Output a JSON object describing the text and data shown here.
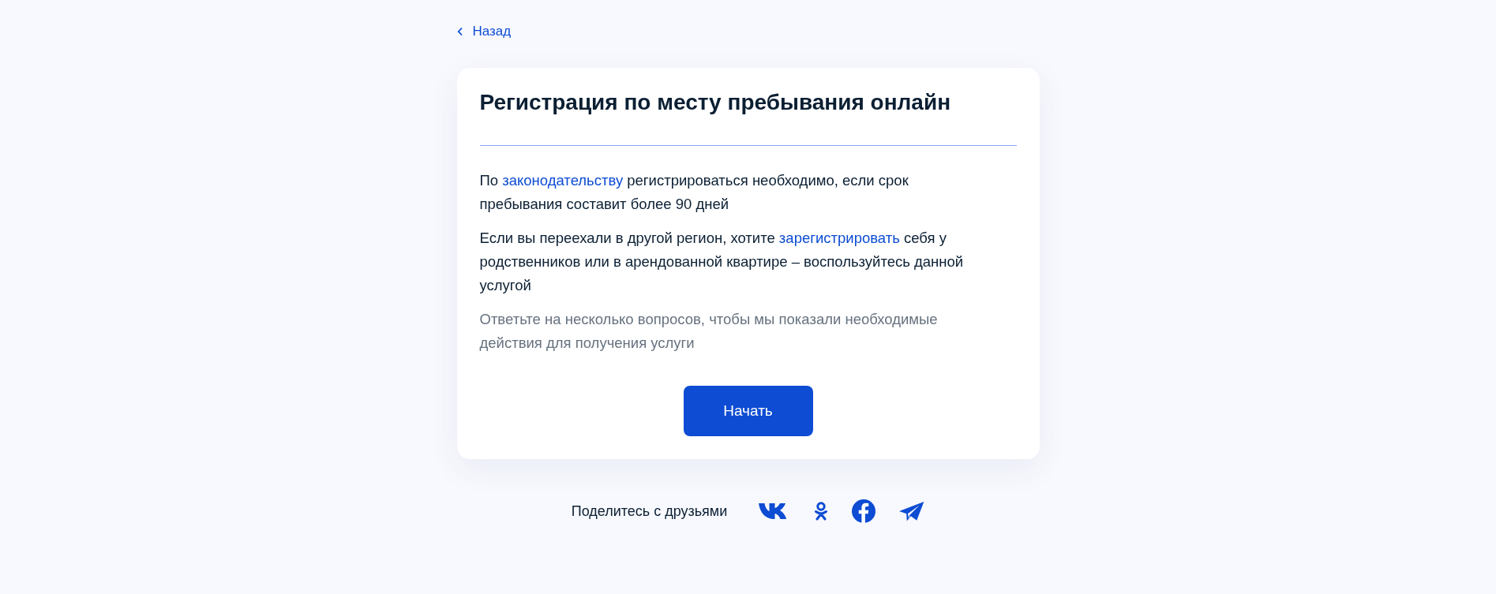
{
  "back_link": {
    "label": "Назад"
  },
  "card": {
    "title": "Регистрация по месту пребывания онлайн",
    "paragraphs": [
      {
        "kind": "body",
        "segments": [
          {
            "kind": "text",
            "text": "По "
          },
          {
            "kind": "link",
            "text": "законодательству"
          },
          {
            "kind": "text",
            "text": " регистрироваться необходимо, если срок пребывания составит более 90 дней"
          }
        ]
      },
      {
        "kind": "body",
        "segments": [
          {
            "kind": "text",
            "text": "Если вы переехали в другой регион, хотите "
          },
          {
            "kind": "link",
            "text": "зарегистрировать"
          },
          {
            "kind": "text",
            "text": " себя у родственников или в арендованной квартире – воспользуйтесь данной услугой"
          }
        ]
      },
      {
        "kind": "hint",
        "segments": [
          {
            "kind": "text",
            "text": "Ответьте на несколько вопросов, чтобы мы показали необходимые действия для получения услуги"
          }
        ]
      }
    ],
    "button": "Начать"
  },
  "share": {
    "label": "Поделитесь с друзьями",
    "networks": [
      {
        "kind": "vk"
      },
      {
        "kind": "ok"
      },
      {
        "kind": "fb"
      },
      {
        "kind": "tg"
      }
    ]
  }
}
